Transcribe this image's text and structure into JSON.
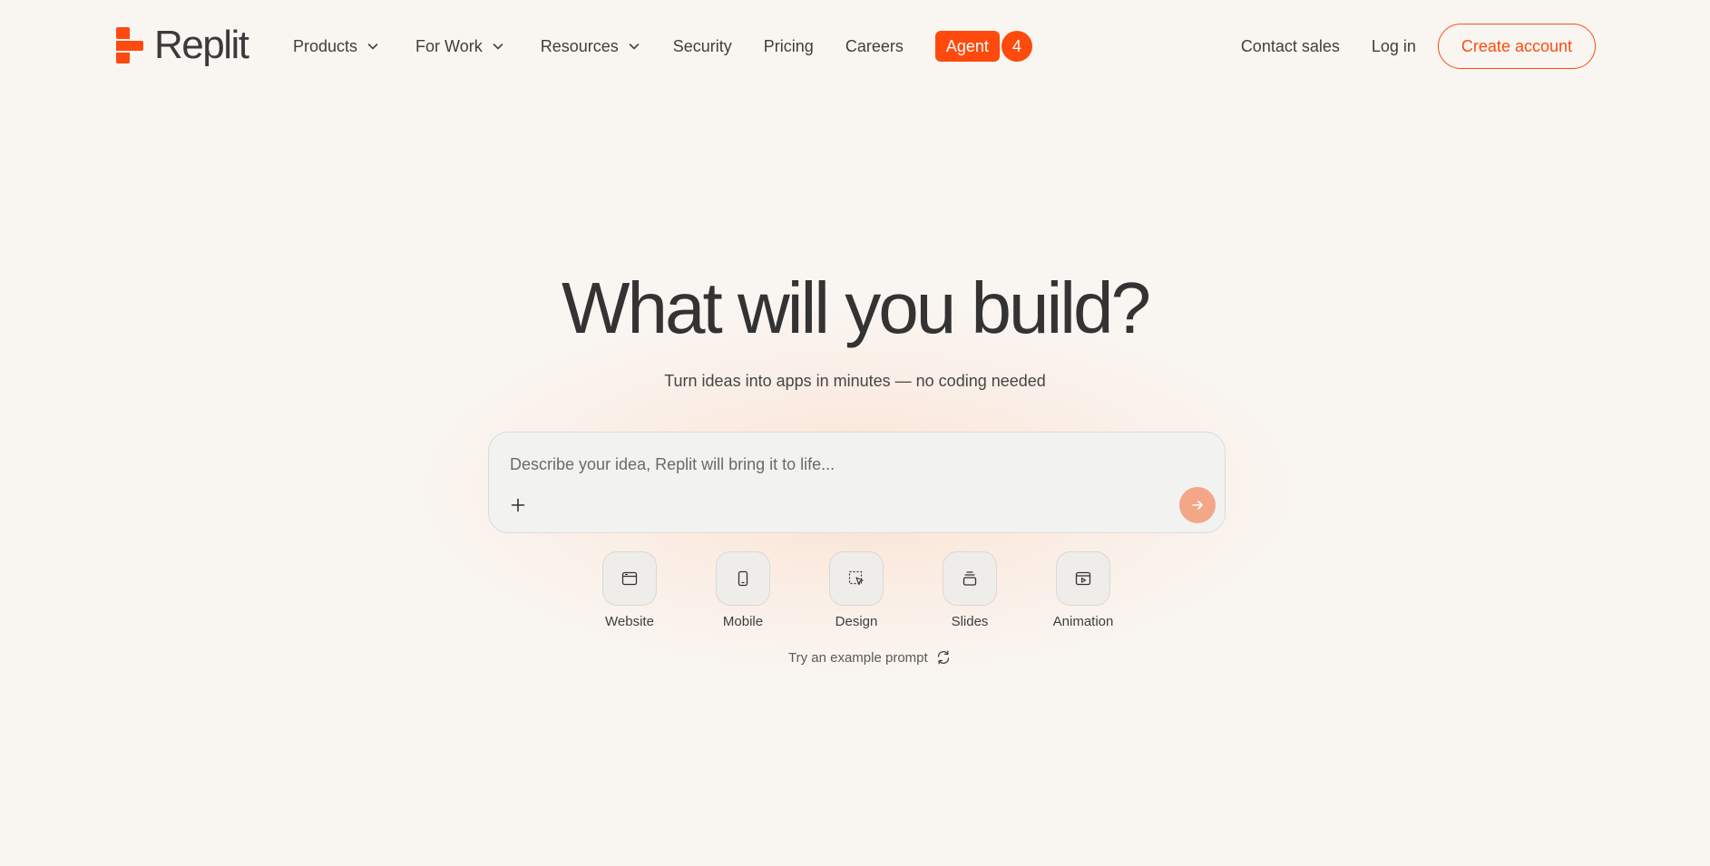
{
  "brand": {
    "name": "Replit",
    "accent": "#ff4a0e"
  },
  "nav": {
    "products": "Products",
    "for_work": "For Work",
    "resources": "Resources",
    "security": "Security",
    "pricing": "Pricing",
    "careers": "Careers",
    "agent_label": "Agent",
    "agent_badge": "4"
  },
  "header_right": {
    "contact_sales": "Contact sales",
    "login": "Log in",
    "create_account": "Create account"
  },
  "hero": {
    "title": "What will you build?",
    "subtitle": "Turn ideas into apps in minutes — no coding needed"
  },
  "prompt": {
    "placeholder": "Describe your idea, Replit will bring it to life...",
    "value": "",
    "send_color": "#f4a787"
  },
  "categories": [
    {
      "label": "Website",
      "icon": "browser-window-icon"
    },
    {
      "label": "Mobile",
      "icon": "mobile-phone-icon"
    },
    {
      "label": "Design",
      "icon": "design-select-icon"
    },
    {
      "label": "Slides",
      "icon": "slides-stack-icon"
    },
    {
      "label": "Animation",
      "icon": "animation-play-icon"
    }
  ],
  "example": {
    "label": "Try an example prompt",
    "icon": "refresh-icon"
  }
}
